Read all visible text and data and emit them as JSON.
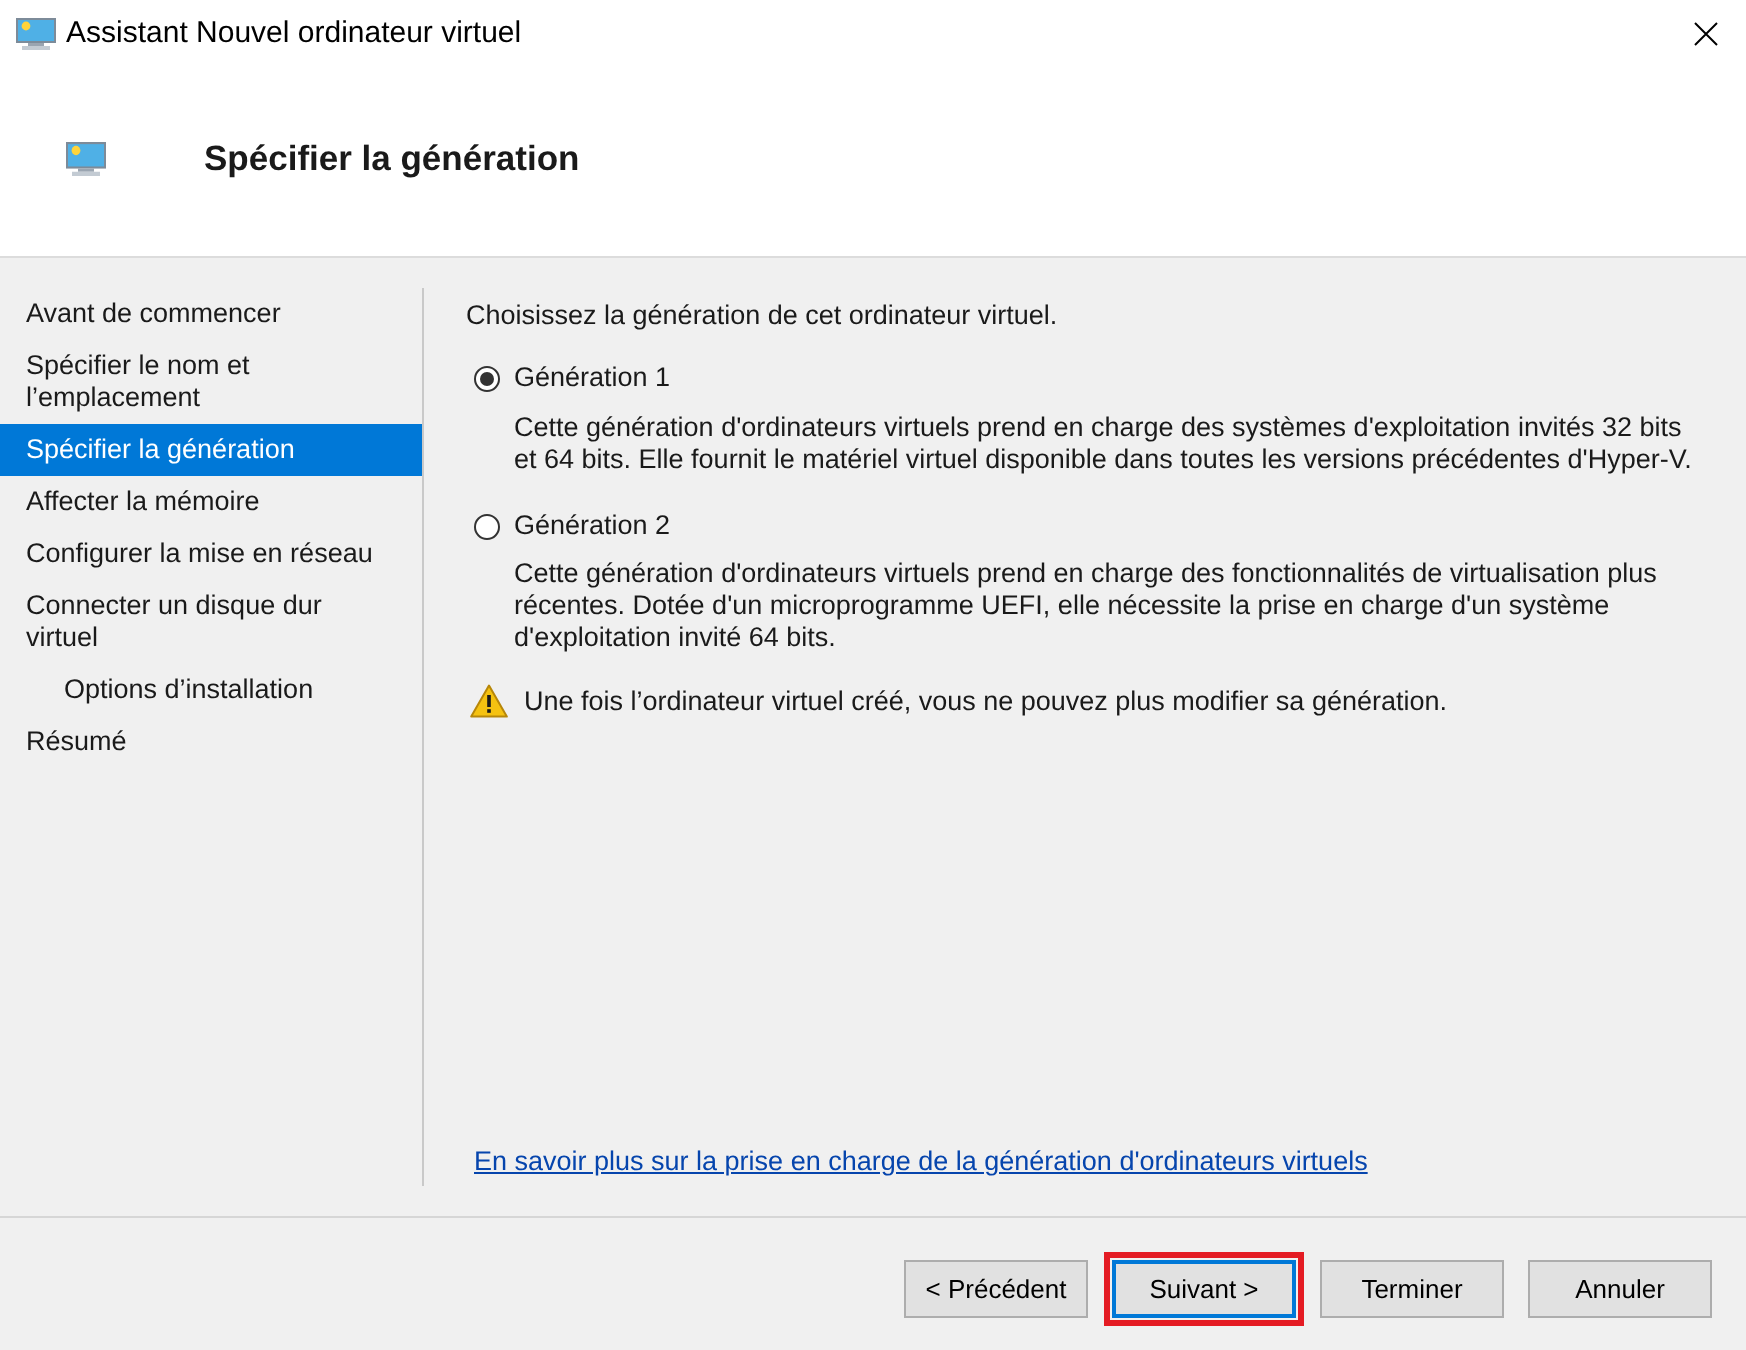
{
  "window": {
    "title": "Assistant Nouvel ordinateur virtuel"
  },
  "header": {
    "title": "Spécifier la génération"
  },
  "sidebar": {
    "items": [
      {
        "label": "Avant de commencer",
        "selected": false
      },
      {
        "label": "Spécifier le nom et l’emplacement",
        "selected": false
      },
      {
        "label": "Spécifier la génération",
        "selected": true
      },
      {
        "label": "Affecter la mémoire",
        "selected": false
      },
      {
        "label": "Configurer la mise en réseau",
        "selected": false
      },
      {
        "label": "Connecter un disque dur virtuel",
        "selected": false,
        "children": [
          {
            "label": "Options d’installation",
            "selected": false
          }
        ]
      },
      {
        "label": "Résumé",
        "selected": false
      }
    ]
  },
  "content": {
    "prompt": "Choisissez la génération de cet ordinateur virtuel.",
    "options": [
      {
        "label": "Génération 1",
        "selected": true,
        "description": "Cette génération d'ordinateurs virtuels prend en charge des systèmes d'exploitation invités 32 bits et 64 bits. Elle fournit le matériel virtuel disponible dans toutes les versions précédentes d'Hyper-V."
      },
      {
        "label": "Génération 2",
        "selected": false,
        "description": "Cette génération d'ordinateurs virtuels prend en charge des fonctionnalités de virtualisation plus récentes. Dotée d'un microprogramme UEFI, elle nécessite la prise en charge d'un système d'exploitation invité 64 bits."
      }
    ],
    "warning": "Une fois l’ordinateur virtuel créé, vous ne pouvez plus modifier sa génération.",
    "link": "En savoir plus sur la prise en charge de la génération d'ordinateurs virtuels"
  },
  "buttons": [
    {
      "label": "< Précédent",
      "default": false,
      "highlighted": false
    },
    {
      "label": "Suivant >",
      "default": true,
      "highlighted": true
    },
    {
      "label": "Terminer",
      "default": false,
      "highlighted": false
    },
    {
      "label": "Annuler",
      "default": false,
      "highlighted": false
    }
  ]
}
